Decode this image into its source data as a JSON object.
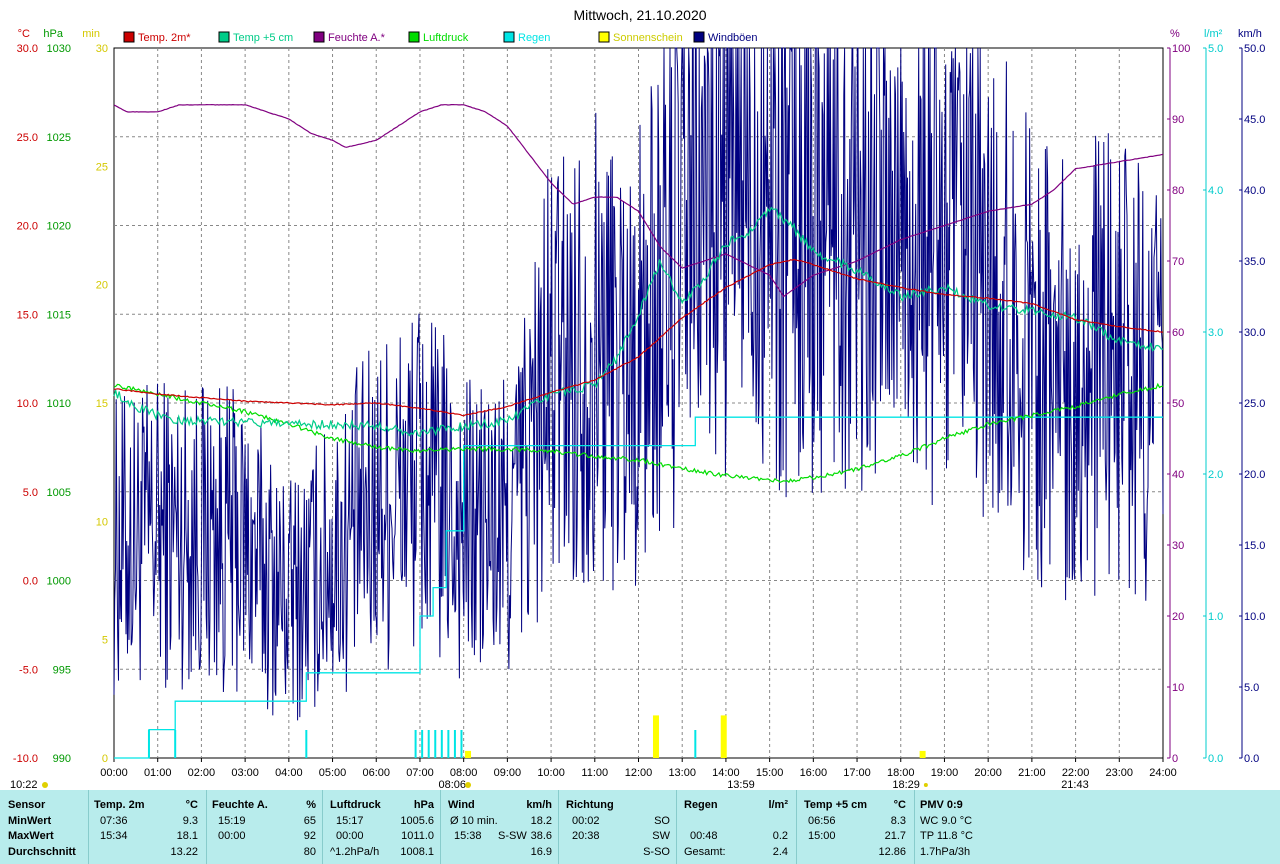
{
  "chart_data": {
    "type": "line",
    "title": "Mittwoch, 21.10.2020",
    "x_ticks": [
      "00:00",
      "01:00",
      "02:00",
      "03:00",
      "04:00",
      "05:00",
      "06:00",
      "07:00",
      "08:00",
      "09:00",
      "10:00",
      "11:00",
      "12:00",
      "13:00",
      "14:00",
      "15:00",
      "16:00",
      "17:00",
      "18:00",
      "19:00",
      "20:00",
      "21:00",
      "22:00",
      "23:00",
      "24:00"
    ],
    "xlim": [
      0,
      24
    ],
    "grid": true,
    "legend_position": "top",
    "axes": {
      "temp": {
        "unit": "°C",
        "ylim": [
          -10,
          30
        ],
        "ticks": [
          "-10.0",
          "-5.0",
          "0.0",
          "5.0",
          "10.0",
          "15.0",
          "20.0",
          "25.0",
          "30.0"
        ]
      },
      "pressure": {
        "unit": "hPa",
        "ylim": [
          990,
          1030
        ],
        "ticks": [
          "990",
          "995",
          "1000",
          "1005",
          "1010",
          "1015",
          "1020",
          "1025",
          "1030"
        ]
      },
      "sunshine": {
        "unit": "min",
        "ylim": [
          0,
          30
        ],
        "ticks": [
          "0",
          "5",
          "10",
          "15",
          "20",
          "25",
          "30"
        ]
      },
      "humidity": {
        "unit": "%",
        "ylim": [
          0,
          100
        ],
        "ticks": [
          "0",
          "10",
          "20",
          "30",
          "40",
          "50",
          "60",
          "70",
          "80",
          "90",
          "100"
        ]
      },
      "rain": {
        "unit": "l/m²",
        "ylim": [
          0,
          5
        ],
        "ticks": [
          "0.0",
          "1.0",
          "2.0",
          "3.0",
          "4.0",
          "5.0"
        ]
      },
      "wind": {
        "unit": "km/h",
        "ylim": [
          0,
          50
        ],
        "ticks": [
          "0.0",
          "5.0",
          "10.0",
          "15.0",
          "20.0",
          "25.0",
          "30.0",
          "35.0",
          "40.0",
          "45.0",
          "50.0"
        ]
      }
    },
    "series": [
      {
        "name": "Temp. 2m*",
        "axis": "temp",
        "color": "#cc0000",
        "x": [
          0,
          1,
          2,
          3,
          4,
          5,
          6,
          7,
          8,
          9,
          10,
          11,
          12,
          13,
          14,
          15,
          15.57,
          16,
          17,
          18,
          19,
          20,
          21,
          22,
          23,
          24
        ],
        "y": [
          10.8,
          10.5,
          10.3,
          10.1,
          10.0,
          9.9,
          10.0,
          9.7,
          9.3,
          9.8,
          10.6,
          11.3,
          12.6,
          14.8,
          16.5,
          17.8,
          18.1,
          17.8,
          17.0,
          16.5,
          16.1,
          15.9,
          15.6,
          14.7,
          14.3,
          14.0
        ]
      },
      {
        "name": "Temp +5 cm",
        "axis": "temp",
        "color": "#00cc88",
        "x": [
          0,
          0.5,
          1,
          1.5,
          2,
          3,
          4,
          5,
          6,
          6.93,
          7.5,
          8,
          9,
          10,
          11,
          11.5,
          12,
          12.5,
          13,
          13.5,
          14,
          14.5,
          15,
          15.5,
          16,
          17,
          18,
          19,
          20,
          21,
          22,
          23,
          24
        ],
        "y": [
          10.6,
          9.8,
          9.3,
          9.0,
          9.0,
          8.9,
          8.8,
          8.8,
          8.7,
          8.3,
          8.5,
          8.7,
          9.0,
          10.5,
          11.0,
          12.5,
          15.0,
          18.0,
          15.5,
          17.0,
          19.0,
          19.5,
          21.0,
          20.0,
          18.5,
          17.5,
          16.0,
          16.5,
          15.5,
          15.2,
          14.8,
          13.5,
          13.0
        ]
      },
      {
        "name": "Feuchte A.*",
        "axis": "humidity",
        "color": "#800080",
        "x": [
          0,
          0.3,
          1,
          1.5,
          2,
          3,
          4,
          4.5,
          5,
          5.3,
          6,
          6.5,
          7,
          7.5,
          8,
          8.5,
          9,
          10,
          10.5,
          11,
          11.5,
          12,
          12.5,
          13,
          13.5,
          14,
          15,
          15.32,
          16,
          17,
          18,
          19,
          20,
          21,
          21.5,
          22,
          23,
          24
        ],
        "y": [
          92,
          91,
          91,
          92,
          92,
          92,
          90,
          88,
          87,
          86,
          87,
          89,
          91,
          92,
          92,
          91,
          89,
          81,
          78,
          79,
          79,
          77,
          72,
          69,
          70,
          71,
          68,
          65,
          68,
          70,
          73,
          75,
          77,
          78,
          80,
          83,
          84,
          85
        ]
      },
      {
        "name": "Luftdruck",
        "axis": "pressure",
        "color": "#00dd00",
        "x": [
          0,
          1,
          2,
          3,
          4,
          5,
          6,
          7,
          8,
          9,
          10,
          11,
          12,
          13,
          14,
          15,
          15.28,
          16,
          17,
          18,
          19,
          20,
          21,
          22,
          23,
          24
        ],
        "y": [
          1011.0,
          1010.5,
          1010.0,
          1009.5,
          1008.8,
          1008.0,
          1007.5,
          1007.3,
          1007.4,
          1007.4,
          1007.3,
          1007.0,
          1006.8,
          1006.3,
          1005.9,
          1005.7,
          1005.6,
          1005.8,
          1006.3,
          1007.0,
          1008.0,
          1008.8,
          1009.3,
          1009.8,
          1010.5,
          1011.0
        ]
      },
      {
        "name": "Regen",
        "axis": "rain",
        "color": "#00e5e5",
        "style": "step",
        "x": [
          0,
          0.8,
          1.4,
          2.5,
          4.4,
          6.0,
          6.9,
          7.0,
          7.3,
          7.6,
          8.0,
          9.0,
          10.0,
          11.0,
          12.0,
          13.0,
          13.3,
          14.0,
          15.0,
          16.0,
          17.0,
          18.0,
          19.0,
          20.0,
          21.0,
          22.0,
          23.0,
          24.0
        ],
        "y": [
          0.0,
          0.2,
          0.4,
          0.4,
          0.6,
          0.6,
          0.6,
          1.0,
          1.2,
          1.6,
          2.2,
          2.2,
          2.2,
          2.2,
          2.2,
          2.2,
          2.4,
          2.4,
          2.4,
          2.4,
          2.4,
          2.4,
          2.4,
          2.4,
          2.4,
          2.4,
          2.4,
          2.4
        ]
      },
      {
        "name": "Sonnenschein",
        "axis": "sunshine",
        "color": "#ffff00",
        "style": "bar",
        "x": [
          8.1,
          12.4,
          13.95,
          18.5
        ],
        "y": [
          0.3,
          1.8,
          1.8,
          0.3
        ]
      },
      {
        "name": "Windböen",
        "axis": "wind",
        "color": "#000080",
        "style": "noisy",
        "x": [
          0,
          1,
          2,
          3,
          4,
          5,
          6,
          7,
          8,
          9,
          10,
          11,
          12,
          13,
          14,
          15,
          15.63,
          16,
          17,
          18,
          19,
          20,
          21,
          22,
          23,
          24
        ],
        "y": [
          15,
          16,
          16,
          15,
          11,
          14,
          18,
          20,
          16,
          16,
          27,
          29,
          28,
          38,
          42,
          42,
          38.6,
          41,
          41,
          38,
          36,
          33,
          29,
          27,
          28,
          26
        ]
      }
    ],
    "markers": {
      "sunrise": "08:06",
      "sun_peak": "13:59",
      "sunset": "18:29",
      "rain_end": "21:43",
      "moonrise": "10:22"
    }
  },
  "stats": {
    "headers": {
      "sensor": "Sensor",
      "temp2m": "Temp. 2m",
      "temp2m_unit": "°C",
      "humidity": "Feuchte A.",
      "humidity_unit": "%",
      "pressure": "Luftdruck",
      "pressure_unit": "hPa",
      "wind": "Wind",
      "wind_unit": "km/h",
      "direction": "Richtung",
      "rain": "Regen",
      "rain_unit": "l/m²",
      "temp5cm": "Temp +5 cm",
      "temp5cm_unit": "°C",
      "pmv": "PMV 0:9"
    },
    "rows": {
      "min": "MinWert",
      "max": "MaxWert",
      "avg": "Durchschnitt"
    },
    "temp2m": {
      "min_time": "07:36",
      "min": "9.3",
      "max_time": "15:34",
      "max": "18.1",
      "avg": "13.22"
    },
    "humidity": {
      "min_time": "15:19",
      "min": "65",
      "max_time": "00:00",
      "max": "92",
      "avg": "80"
    },
    "pressure": {
      "min_time": "15:17",
      "min": "1005.6",
      "max_time": "00:00",
      "max": "1011.0",
      "trend": "^1.2hPa/h",
      "avg": "1008.1"
    },
    "wind": {
      "avg10": "Ø 10 min.",
      "avg10_value": "18.2",
      "gust_time": "15:38",
      "gust_dir": "S-SW",
      "gust": "38.6",
      "avg": "16.9"
    },
    "direction": {
      "t1": "00:02",
      "d1": "SO",
      "t2": "20:38",
      "d2": "SW",
      "avg": "S-SO"
    },
    "rain": {
      "max_time": "00:48",
      "max": "0.2",
      "total_label": "Gesamt:",
      "total": "2.4"
    },
    "temp5cm": {
      "min_time": "06:56",
      "min": "8.3",
      "max_time": "15:00",
      "max": "21.7",
      "avg": "12.86"
    },
    "pmv": {
      "wc": "WC 9.0 °C",
      "tp": "TP 11.8 °C",
      "trend": "1.7hPa/3h"
    }
  }
}
